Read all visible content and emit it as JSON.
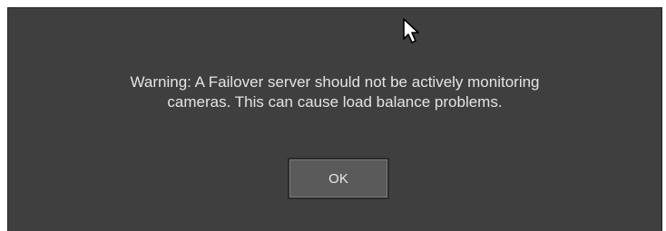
{
  "dialog": {
    "message": "Warning: A Failover server should not be actively monitoring\ncameras.  This can cause load balance problems.",
    "ok_label": "OK"
  },
  "colors": {
    "dialog_background": "#3f3f3f",
    "text": "#e4e4e4",
    "button_background": "#5a5a5a"
  },
  "icons": {
    "cursor": "mouse-pointer-icon"
  }
}
